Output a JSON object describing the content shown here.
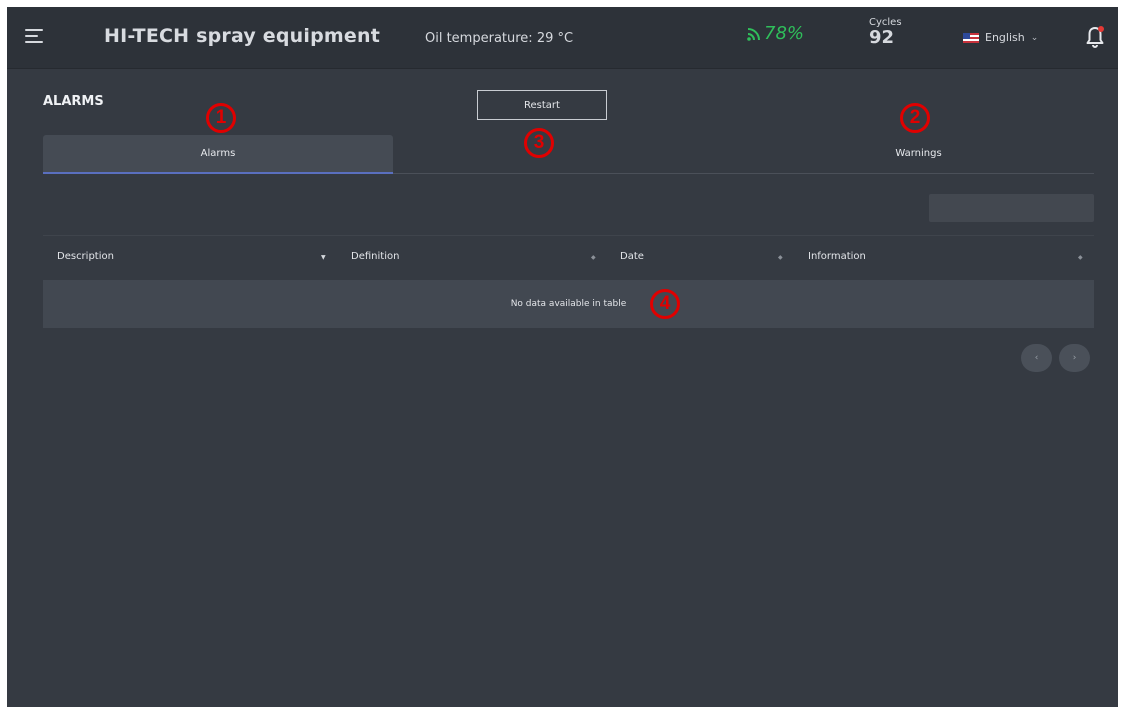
{
  "header": {
    "app_title": "HI-TECH spray equipment",
    "oil_temperature": "Oil temperature: 29 °C",
    "signal_strength": "78%",
    "cycles_label": "Cycles",
    "cycles_value": "92",
    "language": "English",
    "icons": {
      "menu": "menu-icon",
      "signal": "signal-icon",
      "flag": "us-flag-icon",
      "language_chevron": "chevron-down-icon",
      "notifications": "bell-icon"
    }
  },
  "page": {
    "title": "ALARMS",
    "restart_label": "Restart"
  },
  "tabs": [
    {
      "label": "Alarms",
      "active": true
    },
    {
      "label": "Warnings",
      "active": false
    }
  ],
  "search": {
    "value": "",
    "placeholder": ""
  },
  "table": {
    "columns": [
      {
        "label": "Description",
        "sort": "descending"
      },
      {
        "label": "Definition",
        "sort": "none"
      },
      {
        "label": "Date",
        "sort": "none"
      },
      {
        "label": "Information",
        "sort": "none"
      }
    ],
    "empty_message": "No data available in table"
  },
  "pagination": {
    "prev_icon": "chevron-left-icon",
    "next_icon": "chevron-right-icon"
  },
  "annotations": [
    "1",
    "2",
    "3",
    "4"
  ],
  "colors": {
    "background": "#353a42",
    "topbar": "#2d3239",
    "signal_green": "#2fbf5b",
    "active_tab_underline": "#5a6fbf",
    "callout_red": "#e00000"
  }
}
